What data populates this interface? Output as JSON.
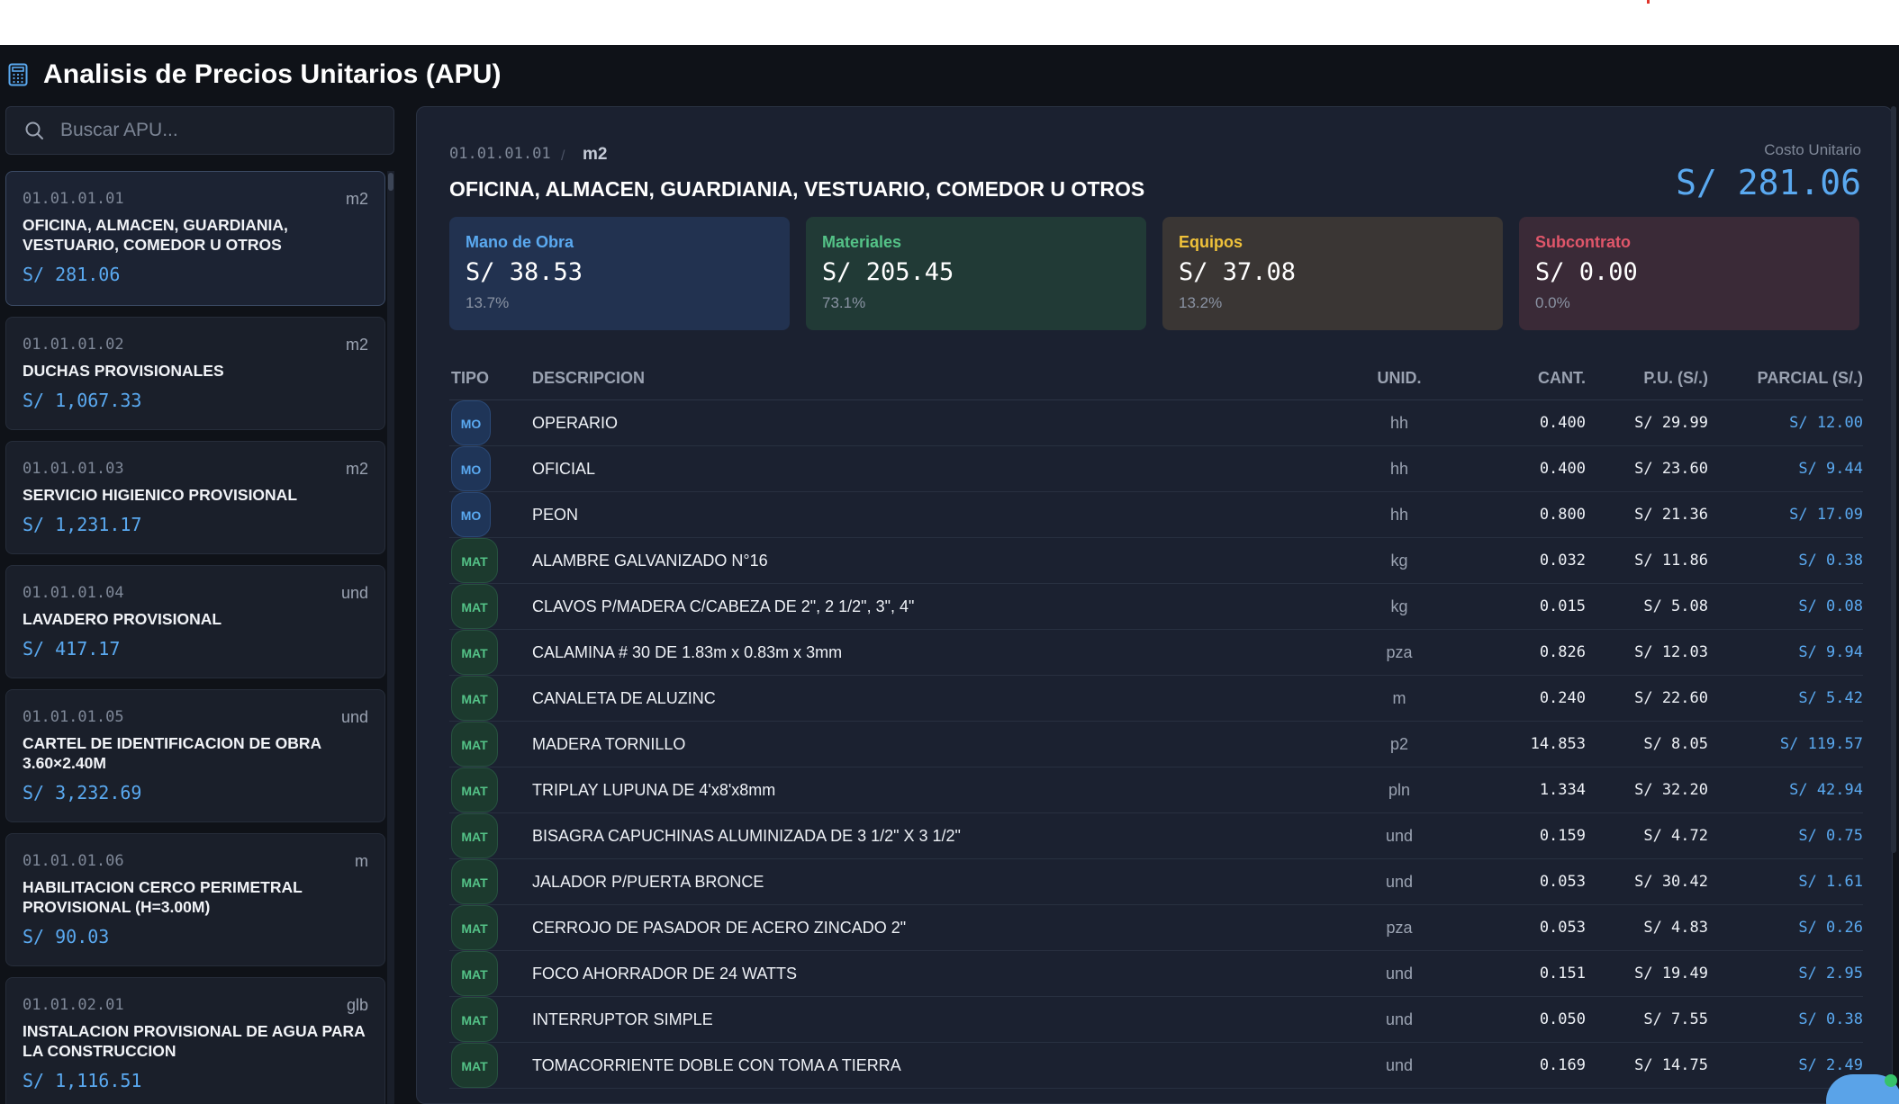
{
  "app": {
    "title": "Analisis de Precios Unitarios (APU)",
    "icon": "calculator-icon",
    "accent_color": "#5aa9f0"
  },
  "search": {
    "placeholder": "Buscar APU...",
    "value": ""
  },
  "apu_list": [
    {
      "code": "01.01.01.01",
      "unit": "m2",
      "name": "OFICINA, ALMACEN, GUARDIANIA, VESTUARIO, COMEDOR U OTROS",
      "price": "S/ 281.06",
      "active": true
    },
    {
      "code": "01.01.01.02",
      "unit": "m2",
      "name": "DUCHAS PROVISIONALES",
      "price": "S/ 1,067.33"
    },
    {
      "code": "01.01.01.03",
      "unit": "m2",
      "name": "SERVICIO HIGIENICO PROVISIONAL",
      "price": "S/ 1,231.17"
    },
    {
      "code": "01.01.01.04",
      "unit": "und",
      "name": "LAVADERO PROVISIONAL",
      "price": "S/ 417.17"
    },
    {
      "code": "01.01.01.05",
      "unit": "und",
      "name": "CARTEL DE IDENTIFICACION DE OBRA 3.60×2.40m",
      "price": "S/ 3,232.69"
    },
    {
      "code": "01.01.01.06",
      "unit": "m",
      "name": "HABILITACION CERCO PERIMETRAL PROVISIONAL (H=3.00m)",
      "price": "S/ 90.03"
    },
    {
      "code": "01.01.02.01",
      "unit": "glb",
      "name": "INSTALACION PROVISIONAL DE AGUA PARA LA CONSTRUCCION",
      "price": "S/ 1,116.51"
    }
  ],
  "detail": {
    "code": "01.01.01.01",
    "unit": "m2",
    "title": "OFICINA, ALMACEN, GUARDIANIA, VESTUARIO, COMEDOR U OTROS",
    "unit_cost_label": "Costo Unitario",
    "unit_cost": "S/ 281.06",
    "summary": [
      {
        "label": "Mano de Obra",
        "value": "S/ 38.53",
        "pct": "13.7%",
        "color": "#5aa9f0",
        "bg": "#223250"
      },
      {
        "label": "Materiales",
        "value": "S/ 205.45",
        "pct": "73.1%",
        "color": "#54c287",
        "bg": "#213a36"
      },
      {
        "label": "Equipos",
        "value": "S/ 37.08",
        "pct": "13.2%",
        "color": "#f0c23a",
        "bg": "#3a3634"
      },
      {
        "label": "Subcontrato",
        "value": "S/ 0.00",
        "pct": "0.0%",
        "color": "#e0566a",
        "bg": "#3a2a37"
      }
    ],
    "columns": {
      "tipo": "TIPO",
      "descripcion": "DESCRIPCION",
      "unid": "UNID.",
      "cant": "CANT.",
      "pu": "P.U. (S/.)",
      "parcial": "PARCIAL (S/.)"
    },
    "rows": [
      {
        "tipo": "MO",
        "desc": "OPERARIO",
        "unid": "hh",
        "cant": "0.400",
        "pu": "S/ 29.99",
        "parcial": "S/ 12.00"
      },
      {
        "tipo": "MO",
        "desc": "OFICIAL",
        "unid": "hh",
        "cant": "0.400",
        "pu": "S/ 23.60",
        "parcial": "S/ 9.44"
      },
      {
        "tipo": "MO",
        "desc": "PEON",
        "unid": "hh",
        "cant": "0.800",
        "pu": "S/ 21.36",
        "parcial": "S/ 17.09"
      },
      {
        "tipo": "MAT",
        "desc": "ALAMBRE GALVANIZADO N°16",
        "unid": "kg",
        "cant": "0.032",
        "pu": "S/ 11.86",
        "parcial": "S/ 0.38"
      },
      {
        "tipo": "MAT",
        "desc": "CLAVOS P/MADERA C/CABEZA DE 2\", 2 1/2\", 3\", 4\"",
        "unid": "kg",
        "cant": "0.015",
        "pu": "S/ 5.08",
        "parcial": "S/ 0.08"
      },
      {
        "tipo": "MAT",
        "desc": "CALAMINA # 30 DE 1.83m x 0.83m x 3mm",
        "unid": "pza",
        "cant": "0.826",
        "pu": "S/ 12.03",
        "parcial": "S/ 9.94"
      },
      {
        "tipo": "MAT",
        "desc": "CANALETA DE ALUZINC",
        "unid": "m",
        "cant": "0.240",
        "pu": "S/ 22.60",
        "parcial": "S/ 5.42"
      },
      {
        "tipo": "MAT",
        "desc": "MADERA TORNILLO",
        "unid": "p2",
        "cant": "14.853",
        "pu": "S/ 8.05",
        "parcial": "S/ 119.57"
      },
      {
        "tipo": "MAT",
        "desc": "TRIPLAY LUPUNA DE 4'x8'x8mm",
        "unid": "pln",
        "cant": "1.334",
        "pu": "S/ 32.20",
        "parcial": "S/ 42.94"
      },
      {
        "tipo": "MAT",
        "desc": "BISAGRA CAPUCHINAS ALUMINIZADA DE 3 1/2\" X 3 1/2\"",
        "unid": "und",
        "cant": "0.159",
        "pu": "S/ 4.72",
        "parcial": "S/ 0.75"
      },
      {
        "tipo": "MAT",
        "desc": "JALADOR P/PUERTA BRONCE",
        "unid": "und",
        "cant": "0.053",
        "pu": "S/ 30.42",
        "parcial": "S/ 1.61"
      },
      {
        "tipo": "MAT",
        "desc": "CERROJO DE PASADOR DE ACERO ZINCADO 2\"",
        "unid": "pza",
        "cant": "0.053",
        "pu": "S/ 4.83",
        "parcial": "S/ 0.26"
      },
      {
        "tipo": "MAT",
        "desc": "FOCO AHORRADOR DE 24 WATTS",
        "unid": "und",
        "cant": "0.151",
        "pu": "S/ 19.49",
        "parcial": "S/ 2.95"
      },
      {
        "tipo": "MAT",
        "desc": "INTERRUPTOR SIMPLE",
        "unid": "und",
        "cant": "0.050",
        "pu": "S/ 7.55",
        "parcial": "S/ 0.38"
      },
      {
        "tipo": "MAT",
        "desc": "TOMACORRIENTE DOBLE CON TOMA A TIERRA",
        "unid": "und",
        "cant": "0.169",
        "pu": "S/ 14.75",
        "parcial": "S/ 2.49"
      }
    ]
  }
}
